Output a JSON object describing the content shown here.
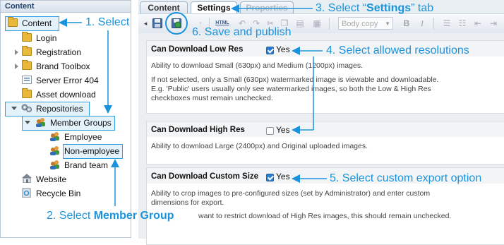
{
  "tree": {
    "header": "Content",
    "nodes": {
      "content": "Content",
      "login": "Login",
      "registration": "Registration",
      "brand_toolbox": "Brand Toolbox",
      "server_error": "Server Error 404",
      "asset_download": "Asset download",
      "repositories": "Repositories",
      "member_groups": "Member Groups",
      "employee": "Employee",
      "non_employee": "Non-employee",
      "brand_team": "Brand team",
      "website": "Website",
      "recycle_bin": "Recycle Bin"
    }
  },
  "tabs": [
    "Content",
    "Settings",
    "Properties"
  ],
  "active_tab": "Settings",
  "toolbar": {
    "html_label": "HTML",
    "format_select_value": "Body copy",
    "bold": "B",
    "italic": "I"
  },
  "sections": [
    {
      "title": "Can Download Low Res",
      "checked": true,
      "checkbox_label": "Yes",
      "desc": [
        "Ability to download Small (630px) and Medium (1200px) images.",
        "If not selected, only a Small (630px) watermarked image is viewable and downloadable.",
        "E.g. 'Public' users usually only see watermarked images, so both the Low & High Res",
        "checkboxes must remain unchecked."
      ]
    },
    {
      "title": "Can Download High Res",
      "checked": false,
      "checkbox_label": "Yes",
      "desc": [
        "Ability to download Large (2400px) and Original uploaded images."
      ]
    },
    {
      "title": "Can Download Custom Size",
      "checked": true,
      "checkbox_label": "Yes",
      "desc": [
        "Ability to crop images to pre-configured sizes (set by Administrator) and enter custom",
        "dimensions for export.",
        "want to restrict download of High Res images, this should remain unchecked."
      ]
    }
  ],
  "callouts": {
    "c1": "1. Select",
    "c2_prefix": "2. Select ",
    "c2_bold": "Member Group",
    "c3_prefix": "3. Select “",
    "c3_bold": "Settings",
    "c3_suffix": "” tab",
    "c4": "4. Select allowed resolutions",
    "c5": "5. Select custom export option",
    "c6": "6. Save and publish"
  },
  "colors": {
    "callout": "#1a93dc",
    "highlight_border": "#2ea0e0",
    "checkbox_checked": "#2a7fd4"
  }
}
